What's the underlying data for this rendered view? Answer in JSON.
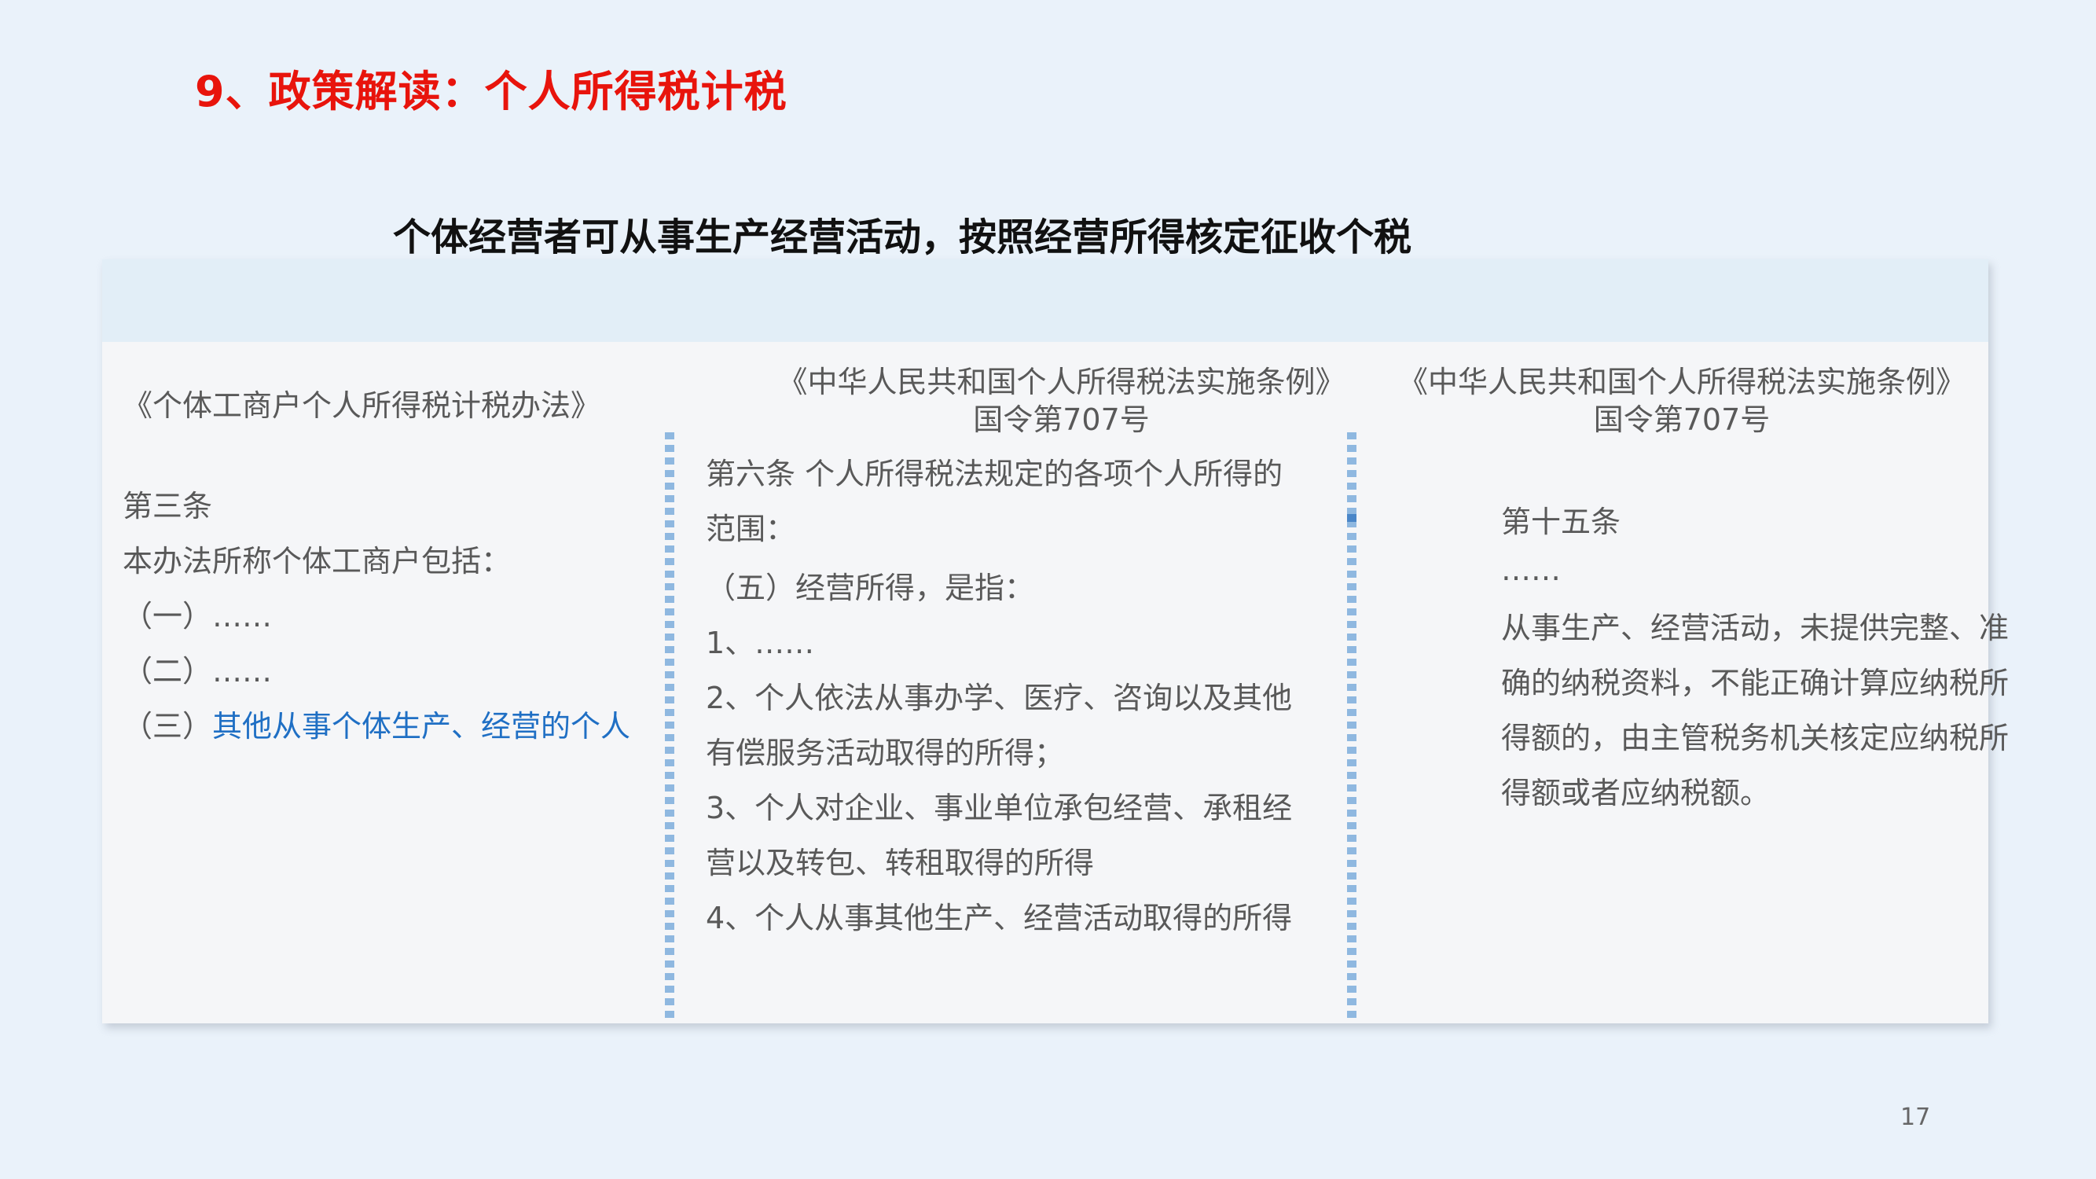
{
  "title": "9、政策解读：个人所得税计税",
  "subtitle": "个体经营者可从事生产经营活动，按照经营所得核定征收个税",
  "columns": [
    {
      "heading": "《个体工商户个人所得税计税办法》",
      "lines": [
        "第三条",
        "本办法所称个体工商户包括：",
        "（一）……",
        "（二）……"
      ],
      "last_prefix": "（三）",
      "last_highlight": "其他从事个体生产、经营的个人"
    },
    {
      "heading": "《中华人民共和国个人所得税法实施条例》",
      "subheading": "国令第707号",
      "lines": [
        "第六条 个人所得税法规定的各项个人所得的",
        "范围：",
        "（五）经营所得，是指：",
        "1、……",
        "2、个人依法从事办学、医疗、咨询以及其他",
        "有偿服务活动取得的所得；",
        "3、个人对企业、事业单位承包经营、承租经",
        "营以及转包、转租取得的所得",
        "4、个人从事其他生产、经营活动取得的所得"
      ]
    },
    {
      "heading": "《中华人民共和国个人所得税法实施条例》",
      "subheading": "国令第707号",
      "lines": [
        "第十五条",
        "……",
        "从事生产、经营活动，未提供完整、准",
        "确的纳税资料，不能正确计算应纳税所",
        "得额的，由主管税务机关核定应纳税所",
        "得额或者应纳税额。"
      ]
    }
  ],
  "page_number": "17",
  "colors": {
    "title": "#e8140c",
    "highlight": "#1f6fc4",
    "body_text": "#595959",
    "divider": "#8fb8e0",
    "background": "#eaf2fa"
  }
}
